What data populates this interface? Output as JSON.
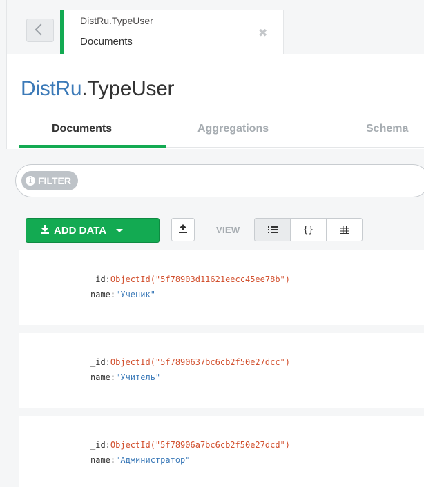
{
  "tab": {
    "namespace": "DistRu.TypeUser",
    "subtitle": "Documents",
    "close_glyph": "✖"
  },
  "title": {
    "database": "DistRu",
    "collection": ".TypeUser"
  },
  "subtabs": [
    "Documents",
    "Aggregations",
    "Schema"
  ],
  "filter": {
    "label": "FILTER",
    "info_glyph": "i"
  },
  "toolbar": {
    "add_data_label": "ADD DATA",
    "view_label": "VIEW",
    "view_modes": [
      "list",
      "json",
      "table"
    ],
    "active_view": "list"
  },
  "documents": [
    {
      "id_key": "_id:",
      "id_value": "ObjectId(\"5f78903d11621eecc45ee78b\")",
      "name_key": "name:",
      "name_value": "\"Ученик\""
    },
    {
      "id_key": "_id:",
      "id_value": "ObjectId(\"5f7890637bc6cb2f50e27dcc\")",
      "name_key": "name:",
      "name_value": "\"Учитель\""
    },
    {
      "id_key": "_id:",
      "id_value": "ObjectId(\"5f78906a7bc6cb2f50e27dcd\")",
      "name_key": "name:",
      "name_value": "\"Администратор\""
    }
  ],
  "colors": {
    "accent_green": "#13aa52",
    "namespace_blue": "#3c7ab8",
    "objectid_orange": "#d2502e"
  }
}
